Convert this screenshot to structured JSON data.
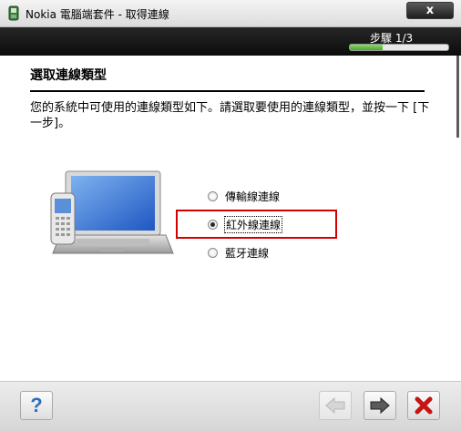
{
  "window": {
    "title": "Nokia 電腦端套件 - 取得連線",
    "close_label": "x"
  },
  "header": {
    "step_label": "步驟 1/3",
    "progress": 0.33
  },
  "content": {
    "page_title": "選取連線類型",
    "instructions": "您的系統中可使用的連線類型如下。請選取要使用的連線類型，並按一下 [下一步]。",
    "options": [
      {
        "label": "傳輸線連線",
        "selected": false
      },
      {
        "label": "紅外線連線",
        "selected": true
      },
      {
        "label": "藍牙連線",
        "selected": false
      }
    ]
  },
  "footer": {
    "help_icon": "question-mark-icon",
    "back_icon": "left-arrow-icon",
    "next_icon": "right-arrow-icon",
    "cancel_icon": "red-x-icon"
  },
  "colors": {
    "highlight_border": "#d40000",
    "header_bg": "#1a1a1a",
    "progress_fill": "#5cb83a"
  }
}
